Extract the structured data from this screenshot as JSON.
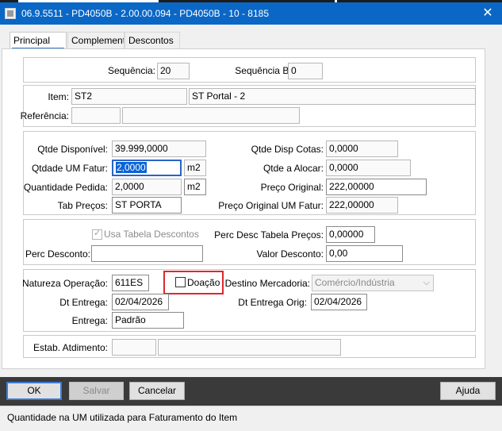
{
  "window": {
    "title": "06.9.5511 - PD4050B - 2.00.00.094 - PD4050B - 10 - 8185",
    "close_glyph": "✕"
  },
  "tabs": [
    {
      "label": "Principal"
    },
    {
      "label": "Complementc"
    },
    {
      "label": "Descontos"
    }
  ],
  "sequencia": {
    "label": "Sequência:",
    "value": "20",
    "bonif_label": "Sequência Bonif:",
    "bonif_value": "0"
  },
  "item": {
    "label": "Item:",
    "code": "ST2",
    "description": "ST Portal - 2",
    "referencia_label": "Referência:",
    "referencia_code": "",
    "referencia_desc": ""
  },
  "quantidades": {
    "qtde_disponivel_label": "Qtde Disponível:",
    "qtde_disponivel": "39.999,0000",
    "qtde_disp_cotas_label": "Qtde Disp Cotas:",
    "qtde_disp_cotas": "0,0000",
    "qtdade_um_fatur_label": "Qtdade UM Fatur:",
    "qtdade_um_fatur": "2,0000",
    "qtdade_um_fatur_unit": "m2",
    "qtde_a_alocar_label": "Qtde a Alocar:",
    "qtde_a_alocar": "0,0000",
    "quantidade_pedida_label": "Quantidade Pedida:",
    "quantidade_pedida": "2,0000",
    "quantidade_pedida_unit": "m2",
    "preco_original_label": "Preço Original:",
    "preco_original": "222,00000",
    "tab_precos_label": "Tab Preços:",
    "tab_precos": "ST PORTA",
    "preco_original_um_fatur_label": "Preço Original UM Fatur:",
    "preco_original_um_fatur": "222,00000"
  },
  "descontos": {
    "usa_tabela_label": "Usa Tabela Descontos",
    "perc_desc_tabela_label": "Perc Desc Tabela Preços:",
    "perc_desc_tabela": "0,00000",
    "perc_desconto_label": "Perc Desconto:",
    "perc_desconto": "",
    "valor_desconto_label": "Valor Desconto:",
    "valor_desconto": "0,00"
  },
  "operacao": {
    "natureza_label": "Natureza Operação:",
    "natureza": "611ES",
    "doacao_label": "Doação",
    "destino_label": "Destino Mercadoria:",
    "destino": "Comércio/Indústria",
    "dt_entrega_label": "Dt Entrega:",
    "dt_entrega": "02/04/2026",
    "dt_entrega_orig_label": "Dt Entrega Orig:",
    "dt_entrega_orig": "02/04/2026",
    "entrega_label": "Entrega:",
    "entrega": "Padrão"
  },
  "estab": {
    "label": "Estab. Atdimento:",
    "code": "",
    "desc": ""
  },
  "buttons": {
    "ok": "OK",
    "salvar": "Salvar",
    "cancelar": "Cancelar",
    "ajuda": "Ajuda"
  },
  "status": {
    "text": "Quantidade na UM utilizada para Faturamento do Item"
  },
  "colors": {
    "titlebar": "#0a67c6",
    "highlight": "#e0262e",
    "focus": "#2a63c9"
  }
}
